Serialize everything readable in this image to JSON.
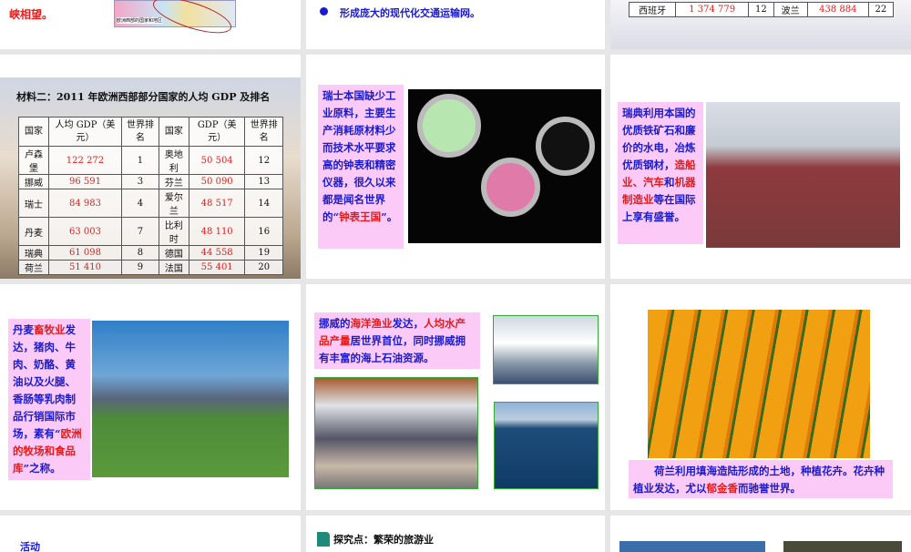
{
  "row0": {
    "slide1": {
      "text_end": "峡相望。",
      "map_caption": "欧洲西部的国家和地区"
    },
    "slide2": {
      "bullet": "形成庞大的现代化交通运输网。"
    },
    "slide3": {
      "row": [
        "西班牙",
        "1 374 779",
        "12",
        "波兰",
        "438 884",
        "22"
      ]
    }
  },
  "row1": {
    "slide1": {
      "title": "材料二：2011 年欧洲西部部分国家的人均 GDP 及排名",
      "headers": [
        "国家",
        "人均 GDP（美元）",
        "世界排名",
        "国家",
        "GDP（美元）",
        "世界排名"
      ],
      "rows": [
        [
          "卢森堡",
          "122 272",
          "1",
          "奥地利",
          "50 504",
          "12"
        ],
        [
          "挪威",
          "96 591",
          "3",
          "芬兰",
          "50 090",
          "13"
        ],
        [
          "瑞士",
          "84 983",
          "4",
          "爱尔兰",
          "48 517",
          "14"
        ],
        [
          "丹麦",
          "63 003",
          "7",
          "比利时",
          "48 110",
          "16"
        ],
        [
          "瑞典",
          "61 098",
          "8",
          "德国",
          "44 558",
          "19"
        ],
        [
          "荷兰",
          "51 410",
          "9",
          "法国",
          "55 401",
          "20"
        ]
      ]
    },
    "slide2": {
      "text": "瑞士本国缺少工业原料，主要生产消耗原材料少而技术水平要求高的钟表和精密仪器，很久以来都是闻名世界的“",
      "highlight": "钟表王国",
      "text_end": "”。"
    },
    "slide3": {
      "text": "瑞典利用本国的优质铁矿石和廉价的水电，冶炼优质钢材，",
      "highlight1": "造船业、汽车",
      "mid": "和",
      "highlight2": "机器制造业",
      "text_end": "等在国际上享有盛誉。"
    }
  },
  "row2": {
    "slide1": {
      "t1": "丹麦",
      "h1": "畜牧业",
      "t2": "发达，猪肉、牛肉、奶酪、黄油以及火腿、香肠等乳肉制品行销国际市场，素有“",
      "h2": "欧洲的牧场和食品库",
      "t3": "”之称。"
    },
    "slide2": {
      "t1": "挪威的",
      "h1": "海洋渔业",
      "t2": "发达，",
      "h2": "人均水产品产量",
      "t3": "居世界首位，同时挪威拥有丰富的海上石油资源。"
    },
    "slide3": {
      "t1": "荷兰利用填海造陆形成的土地，种植花卉。花卉种植业发达，尤以",
      "h1": "郁金香",
      "t2": "而驰誉世界。"
    }
  },
  "row3": {
    "slide1": {
      "text": "活动"
    },
    "slide2": {
      "heading": "探究点：繁荣的旅游业"
    }
  }
}
